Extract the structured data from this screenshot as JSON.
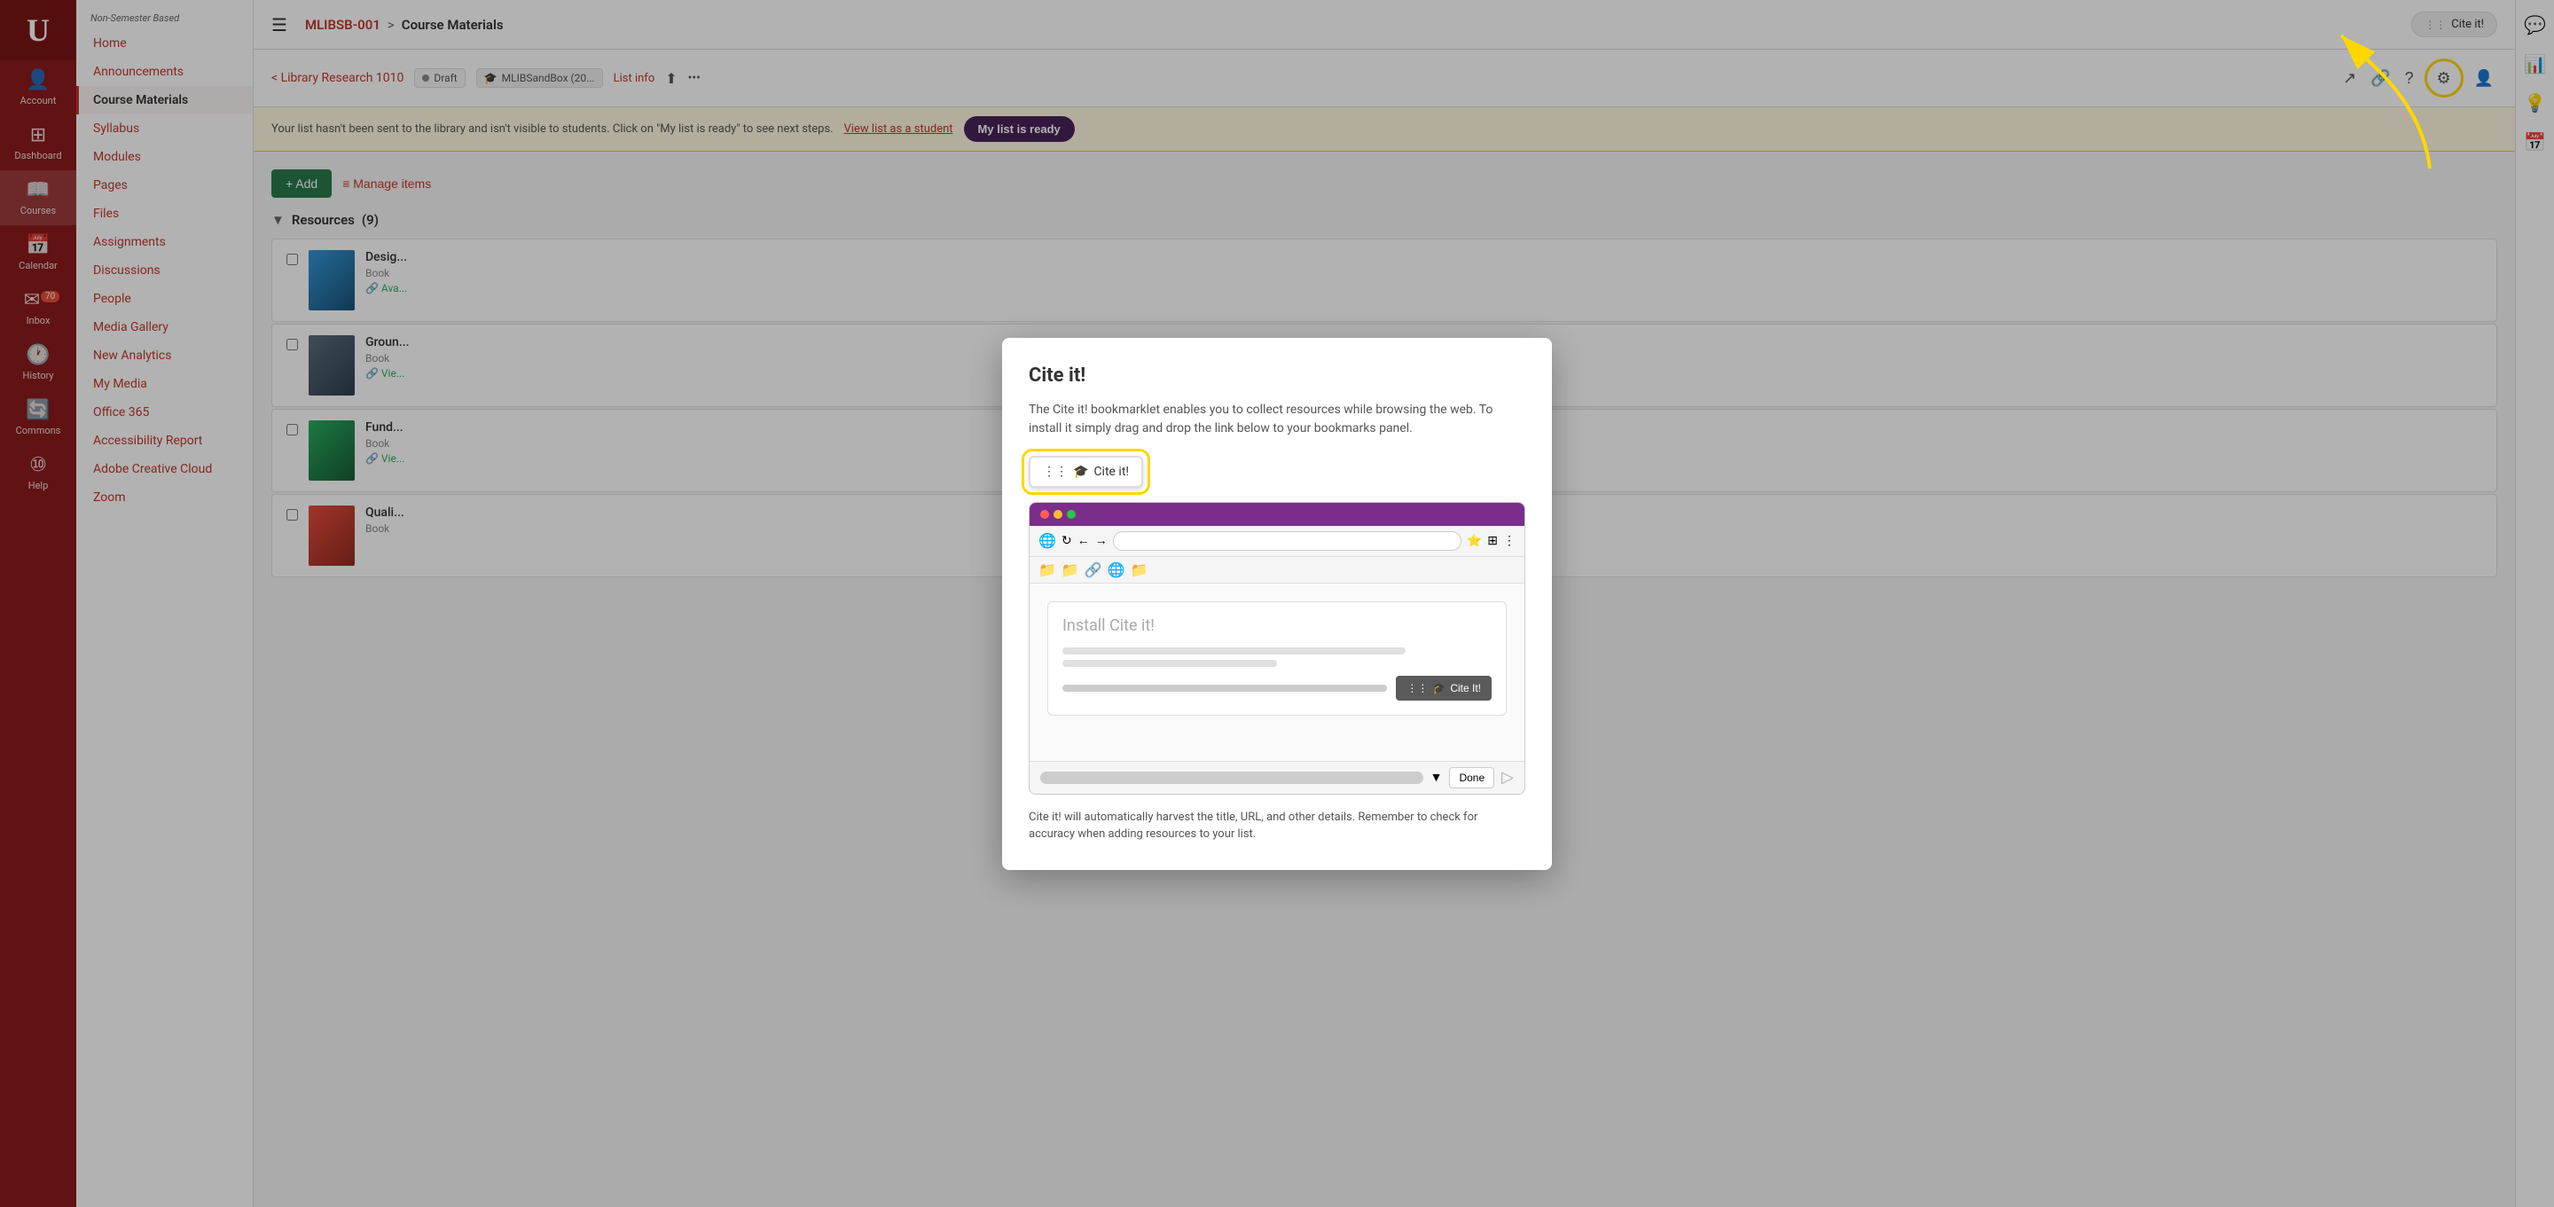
{
  "app": {
    "logo": "U"
  },
  "sidebar_left": {
    "items": [
      {
        "id": "account",
        "label": "Account",
        "icon": "👤"
      },
      {
        "id": "dashboard",
        "label": "Dashboard",
        "icon": "⊞"
      },
      {
        "id": "courses",
        "label": "Courses",
        "icon": "📖"
      },
      {
        "id": "calendar",
        "label": "Calendar",
        "icon": "📅"
      },
      {
        "id": "inbox",
        "label": "Inbox",
        "icon": "✉",
        "badge": "70"
      },
      {
        "id": "history",
        "label": "History",
        "icon": "🕐"
      },
      {
        "id": "commons",
        "label": "Commons",
        "icon": "🔄"
      },
      {
        "id": "help",
        "label": "Help",
        "icon": "⑩"
      }
    ]
  },
  "sidebar_nav": {
    "label": "Non-Semester Based",
    "items": [
      {
        "id": "home",
        "label": "Home",
        "active": false
      },
      {
        "id": "announcements",
        "label": "Announcements",
        "active": false
      },
      {
        "id": "course-materials",
        "label": "Course Materials",
        "active": true
      },
      {
        "id": "syllabus",
        "label": "Syllabus",
        "active": false
      },
      {
        "id": "modules",
        "label": "Modules",
        "active": false
      },
      {
        "id": "pages",
        "label": "Pages",
        "active": false
      },
      {
        "id": "files",
        "label": "Files",
        "active": false
      },
      {
        "id": "assignments",
        "label": "Assignments",
        "active": false
      },
      {
        "id": "discussions",
        "label": "Discussions",
        "active": false
      },
      {
        "id": "people",
        "label": "People",
        "active": false
      },
      {
        "id": "media-gallery",
        "label": "Media Gallery",
        "active": false
      },
      {
        "id": "new-analytics",
        "label": "New Analytics",
        "active": false
      },
      {
        "id": "my-media",
        "label": "My Media",
        "active": false
      },
      {
        "id": "office-365",
        "label": "Office 365",
        "active": false
      },
      {
        "id": "accessibility",
        "label": "Accessibility Report",
        "active": false
      },
      {
        "id": "adobe",
        "label": "Adobe Creative Cloud",
        "active": false
      },
      {
        "id": "zoom",
        "label": "Zoom",
        "active": false
      }
    ]
  },
  "top_bar": {
    "menu_icon": "☰",
    "breadcrumb": {
      "parent": "MLIBSB-001",
      "separator": ">",
      "current": "Course Materials"
    },
    "cite_it_btn": {
      "label": "Cite it!",
      "grid_icon": "⋮⋮"
    }
  },
  "course_header": {
    "back": "< Library Research 1010",
    "draft_label": "Draft",
    "mlib_label": "MLIBSandBox (20...",
    "list_info": "List info",
    "settings_icon": "⚙"
  },
  "banner": {
    "text": "Your list hasn't been sent to the library and isn't visible to students. Click on \"My list is ready\" to see next steps.",
    "view_student_label": "View list as a student",
    "my_list_ready_label": "My list is ready"
  },
  "content": {
    "add_label": "+ Add",
    "manage_label": "≡ Manage items",
    "section": {
      "name": "Resources",
      "count": "(9)"
    },
    "resources": [
      {
        "id": 1,
        "title": "Desig...",
        "type": "Book",
        "link": "Ava...",
        "thumb_class": "thumb-1"
      },
      {
        "id": 2,
        "title": "Groun...",
        "type": "Book",
        "link": "Vie...",
        "thumb_class": "thumb-2"
      },
      {
        "id": 3,
        "title": "Fund...",
        "type": "Book",
        "link": "Vie...",
        "thumb_class": "thumb-3"
      },
      {
        "id": 4,
        "title": "Quali...",
        "type": "Book",
        "link": "",
        "thumb_class": "thumb-4"
      }
    ]
  },
  "modal": {
    "title": "Cite it!",
    "description": "The Cite it! bookmarklet enables you to collect resources while browsing the web. To install it simply drag and drop the link below to your bookmarks panel.",
    "bookmarklet_label": "Cite it!",
    "browser": {
      "install_title": "Install Cite it!",
      "cite_it_label": "Cite It!",
      "done_label": "Done"
    },
    "footer_text": "Cite it! will automatically harvest the title, URL, and other details. Remember to check for accuracy when adding resources to your list."
  }
}
